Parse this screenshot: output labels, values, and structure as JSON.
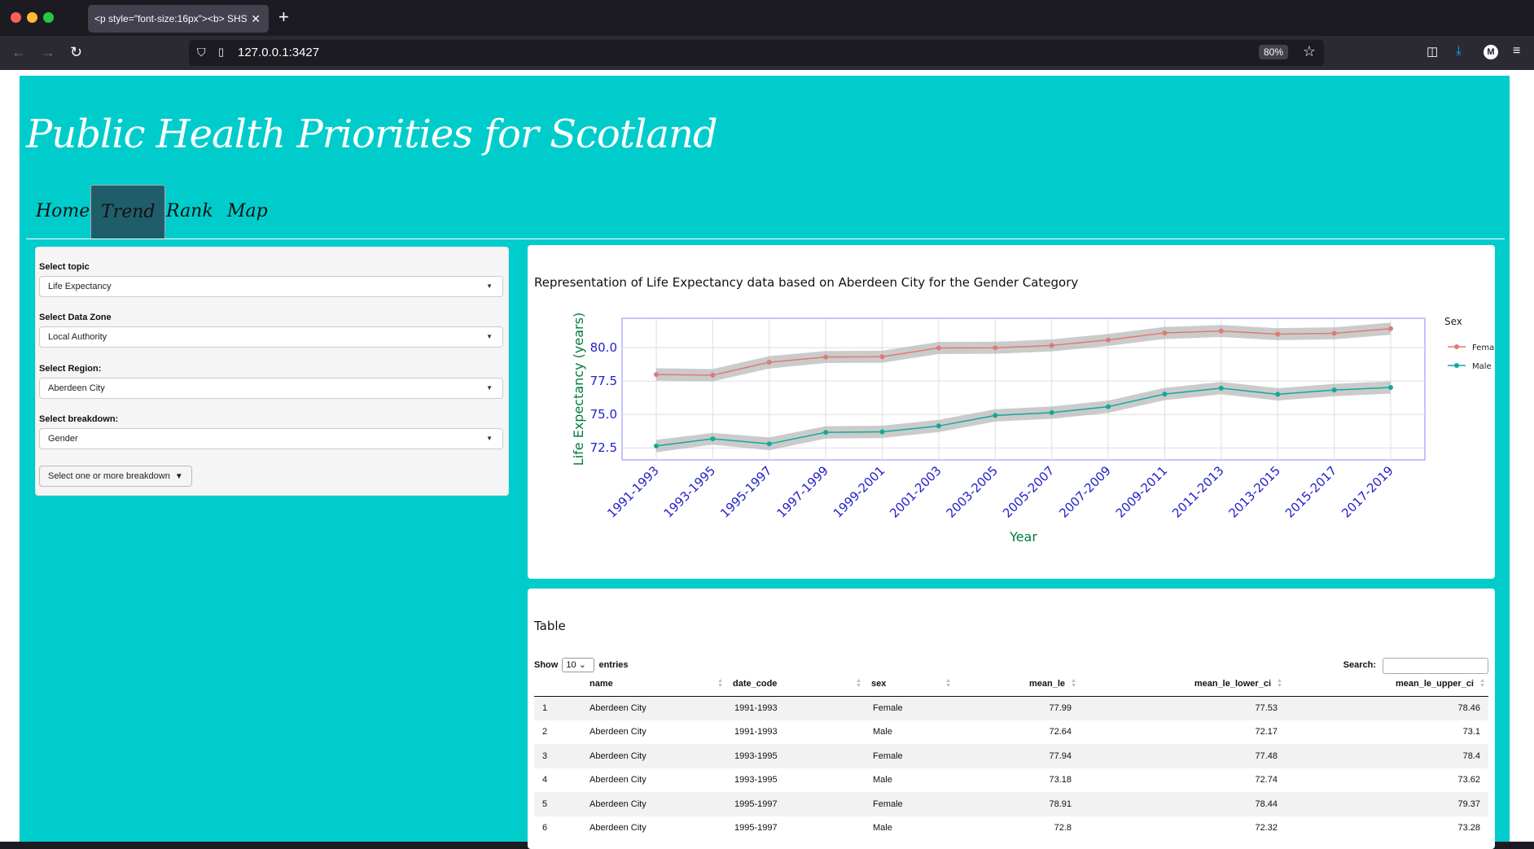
{
  "browser": {
    "tab_title": "<p style=\"font-size:16px\"><b> SHS",
    "url": "127.0.0.1:3427",
    "zoom": "80%",
    "profile_initial": "M"
  },
  "app": {
    "title": "Public Health Priorities for Scotland",
    "tabs": [
      "Home",
      "Trend",
      "Rank",
      "Map"
    ],
    "active_tab": "Trend"
  },
  "sidebar": {
    "topic_label": "Select topic",
    "topic_value": "Life Expectancy",
    "zone_label": "Select Data Zone",
    "zone_value": "Local Authority",
    "region_label": "Select Region:",
    "region_value": "Aberdeen City",
    "breakdown_label": "Select breakdown:",
    "breakdown_value": "Gender",
    "multi_button": "Select one or more breakdown"
  },
  "chart_panel": {
    "title": "Representation of Life Expectancy data based on Aberdeen City for the Gender Category"
  },
  "chart_data": {
    "type": "line",
    "xlabel": "Year",
    "ylabel": "Life Expectancy (years)",
    "legend_title": "Sex",
    "legend_position": "right",
    "ylim": [
      71.6,
      82.2
    ],
    "yticks": [
      72.5,
      75.0,
      77.5,
      80.0
    ],
    "ytick_labels": [
      "72.5",
      "75.0",
      "77.5",
      "80.0"
    ],
    "grid": true,
    "categories": [
      "1991-1993",
      "1993-1995",
      "1995-1997",
      "1997-1999",
      "1999-2001",
      "2001-2003",
      "2003-2005",
      "2005-2007",
      "2007-2009",
      "2009-2011",
      "2011-2013",
      "2013-2015",
      "2015-2017",
      "2017-2019"
    ],
    "series": [
      {
        "name": "Female",
        "color": "#e07b73",
        "values": [
          77.99,
          77.94,
          78.91,
          79.3,
          79.32,
          79.98,
          79.99,
          80.17,
          80.58,
          81.1,
          81.25,
          81.01,
          81.07,
          81.42
        ],
        "lower": [
          77.53,
          77.48,
          78.44,
          78.85,
          78.87,
          79.53,
          79.54,
          79.72,
          80.13,
          80.65,
          80.8,
          80.56,
          80.62,
          80.97
        ],
        "upper": [
          78.46,
          78.4,
          79.37,
          79.75,
          79.77,
          80.43,
          80.44,
          80.62,
          81.03,
          81.55,
          81.7,
          81.46,
          81.52,
          81.87
        ]
      },
      {
        "name": "Male",
        "color": "#13a89e",
        "values": [
          72.64,
          73.18,
          72.8,
          73.66,
          73.7,
          74.14,
          74.93,
          75.14,
          75.58,
          76.53,
          76.97,
          76.51,
          76.83,
          77.02
        ],
        "lower": [
          72.17,
          72.74,
          72.32,
          73.2,
          73.24,
          73.68,
          74.47,
          74.68,
          75.12,
          76.07,
          76.51,
          76.05,
          76.37,
          76.56
        ],
        "upper": [
          73.1,
          73.62,
          73.28,
          74.12,
          74.16,
          74.6,
          75.39,
          75.6,
          76.04,
          76.99,
          77.43,
          76.97,
          77.29,
          77.48
        ]
      }
    ]
  },
  "table_panel": {
    "title": "Table",
    "show_label": "Show",
    "entries_value": "10",
    "entries_label": "entries",
    "search_label": "Search:",
    "columns": [
      "",
      "name",
      "date_code",
      "sex",
      "mean_le",
      "mean_le_lower_ci",
      "mean_le_upper_ci"
    ],
    "rows": [
      [
        "1",
        "Aberdeen City",
        "1991-1993",
        "Female",
        "77.99",
        "77.53",
        "78.46"
      ],
      [
        "2",
        "Aberdeen City",
        "1991-1993",
        "Male",
        "72.64",
        "72.17",
        "73.1"
      ],
      [
        "3",
        "Aberdeen City",
        "1993-1995",
        "Female",
        "77.94",
        "77.48",
        "78.4"
      ],
      [
        "4",
        "Aberdeen City",
        "1993-1995",
        "Male",
        "73.18",
        "72.74",
        "73.62"
      ],
      [
        "5",
        "Aberdeen City",
        "1995-1997",
        "Female",
        "78.91",
        "78.44",
        "79.37"
      ],
      [
        "6",
        "Aberdeen City",
        "1995-1997",
        "Male",
        "72.8",
        "72.32",
        "73.28"
      ]
    ]
  }
}
